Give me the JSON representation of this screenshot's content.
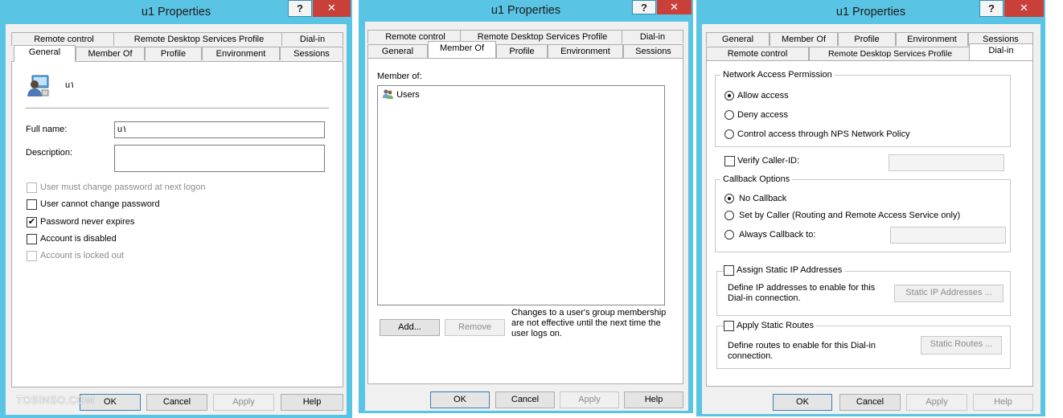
{
  "window_title": "u1 Properties",
  "title_buttons": {
    "help": "?",
    "close": "✕"
  },
  "watermark": "TOSINSO.COM",
  "dialog_buttons": {
    "ok": "OK",
    "cancel": "Cancel",
    "apply": "Apply",
    "help": "Help"
  },
  "tabs": {
    "remote_control": "Remote control",
    "rds_profile": "Remote Desktop Services Profile",
    "rds_profile_narrow": "Remote Desktop Services Profile",
    "dial_in": "Dial-in",
    "general": "General",
    "member_of": "Member Of",
    "profile": "Profile",
    "environment": "Environment",
    "sessions": "Sessions"
  },
  "general": {
    "user_name": "u١",
    "full_name_label": "Full name:",
    "full_name_value": "u١",
    "description_label": "Description:",
    "description_value": "",
    "options": [
      {
        "label": "User must change password at next logon",
        "checked": false,
        "enabled": false
      },
      {
        "label": "User cannot change password",
        "checked": false,
        "enabled": true
      },
      {
        "label": "Password never expires",
        "checked": true,
        "enabled": true
      },
      {
        "label": "Account is disabled",
        "checked": false,
        "enabled": true
      },
      {
        "label": "Account is locked out",
        "checked": false,
        "enabled": false
      }
    ]
  },
  "member_of": {
    "label": "Member of:",
    "groups": [
      "Users"
    ],
    "add_button": "Add...",
    "remove_button": "Remove",
    "note": "Changes to a user's group membership are not effective until the next time the user logs on.",
    "note_lines": [
      "Changes to a user's group membership",
      "are not effective until the next time the",
      "user logs on."
    ]
  },
  "dial_in": {
    "nap_group": "Network Access Permission",
    "allow_access": "Allow access",
    "deny_access": "Deny access",
    "nps_control": "Control access through NPS Network Policy",
    "verify_caller_id": "Verify Caller-ID:",
    "callback_group": "Callback Options",
    "no_callback": "No Callback",
    "set_by_caller": "Set by Caller (Routing and Remote Access Service only)",
    "always_callback": "Always Callback to:",
    "static_ip_group": "Assign Static IP Addresses",
    "static_ip_desc_lines": [
      "Define IP addresses to enable for this",
      "Dial-in connection."
    ],
    "static_ip_button": "Static IP Addresses ...",
    "static_routes_group": "Apply Static Routes",
    "static_routes_desc_lines": [
      "Define routes to enable for this Dial-in",
      "connection."
    ],
    "static_routes_button": "Static Routes ..."
  }
}
